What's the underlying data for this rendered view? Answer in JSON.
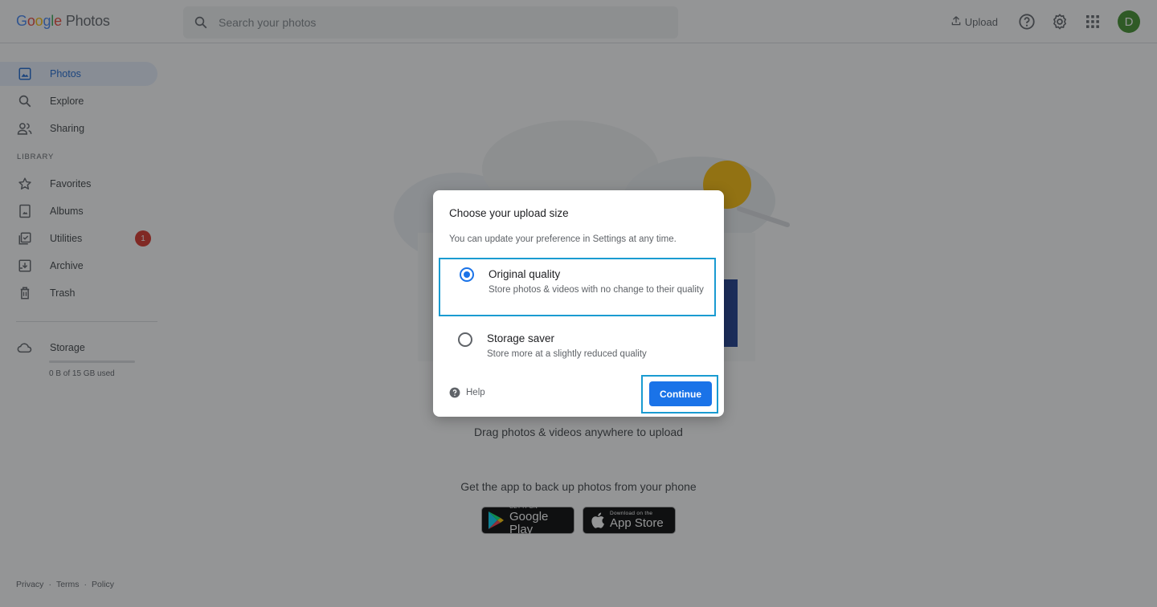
{
  "header": {
    "logo_letters": [
      "G",
      "o",
      "o",
      "g",
      "l",
      "e"
    ],
    "logo_product": "Photos",
    "search_placeholder": "Search your photos",
    "upload_label": "Upload",
    "avatar_initial": "D"
  },
  "sidebar": {
    "items": [
      {
        "label": "Photos",
        "icon": "photo-icon",
        "active": true
      },
      {
        "label": "Explore",
        "icon": "search-icon"
      },
      {
        "label": "Sharing",
        "icon": "people-icon"
      }
    ],
    "library_label": "LIBRARY",
    "library_items": [
      {
        "label": "Favorites",
        "icon": "star-icon"
      },
      {
        "label": "Albums",
        "icon": "album-icon"
      },
      {
        "label": "Utilities",
        "icon": "utilities-icon",
        "badge": "1"
      },
      {
        "label": "Archive",
        "icon": "archive-icon"
      },
      {
        "label": "Trash",
        "icon": "trash-icon"
      }
    ],
    "storage_label": "Storage",
    "storage_used": "0 B of 15 GB used",
    "storage_fraction": 0,
    "footer": [
      "Privacy",
      "Terms",
      "Policy"
    ]
  },
  "main": {
    "drag_text": "Drag photos & videos anywhere to upload",
    "get_app_text": "Get the app to back up photos from your phone",
    "google_play_small": "GET IT ON",
    "google_play_big": "Google Play",
    "app_store_small": "Download on the",
    "app_store_big": "App Store"
  },
  "dialog": {
    "title": "Choose your upload size",
    "subtitle": "You can update your preference in Settings at any time.",
    "options": [
      {
        "title": "Original quality",
        "description": "Store photos & videos with no change to their quality",
        "selected": true
      },
      {
        "title": "Storage saver",
        "description": "Store more at a slightly reduced quality",
        "selected": false
      }
    ],
    "help_label": "Help",
    "continue_label": "Continue"
  },
  "colors": {
    "accent": "#1a73e8",
    "highlight_outline": "#1a9bd1",
    "badge": "#d93025",
    "avatar": "#3e8e2a"
  }
}
